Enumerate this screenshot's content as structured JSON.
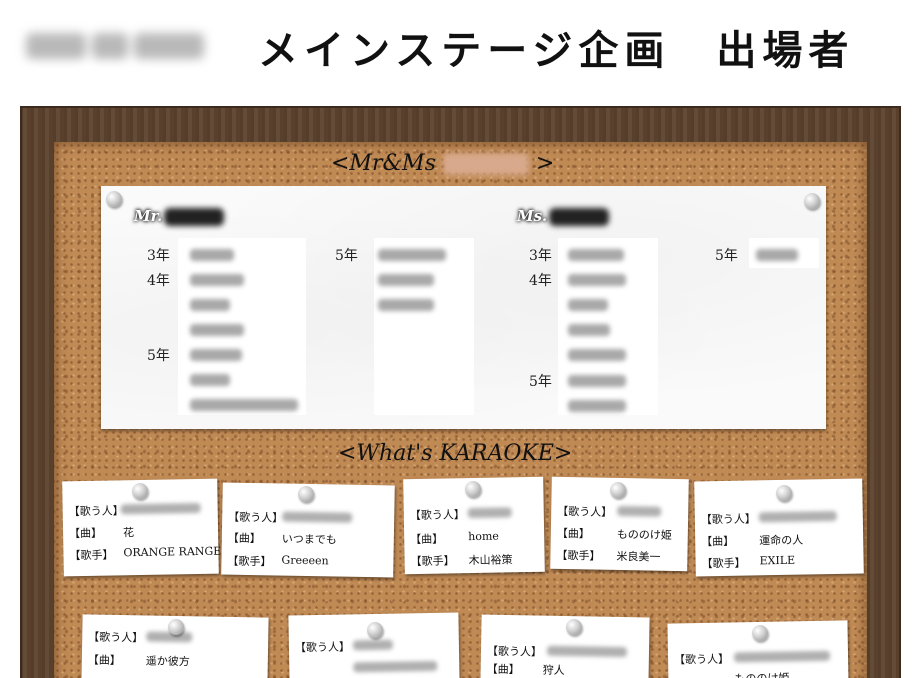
{
  "page_title": "メインステージ企画　出場者",
  "mrms_section": {
    "heading_prefix": "<Mr&Ms",
    "heading_suffix": ">",
    "mr_label": "Mr.",
    "ms_label": "Ms.",
    "mr_grades": [
      "3年",
      "4年",
      "5年"
    ],
    "mr_grade_extra": "5年",
    "ms_grades": [
      "3年",
      "4年",
      "5年"
    ],
    "ms_grade_extra": "5年"
  },
  "karaoke_section": {
    "heading": "<What's KARAOKE>",
    "labels": {
      "singer": "【歌う人】",
      "song": "【曲】",
      "artist": "【歌手】"
    },
    "notes": [
      {
        "song": "花",
        "artist": "ORANGE RANGE"
      },
      {
        "song": "いつまでも",
        "artist": "Greeeen"
      },
      {
        "song": "home",
        "artist": "木山裕策"
      },
      {
        "song": "もののけ姫",
        "artist": "米良美一"
      },
      {
        "song": "運命の人",
        "artist": "EXILE"
      },
      {
        "song": "遥か彼方"
      },
      {
        "song": ""
      },
      {
        "song": "狩人"
      },
      {
        "song": "もののけ姫"
      }
    ]
  }
}
